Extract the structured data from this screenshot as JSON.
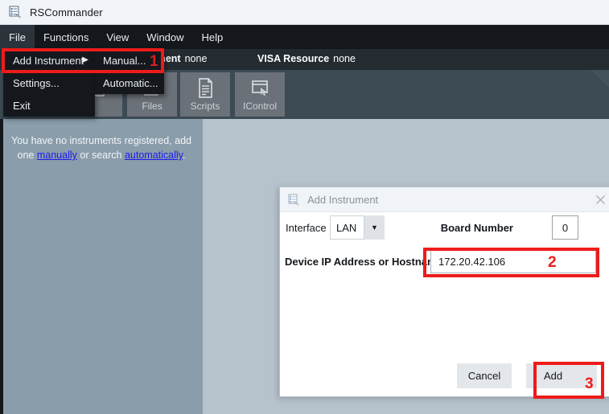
{
  "window": {
    "title": "RSCommander",
    "icon": "instrument-list-icon"
  },
  "menubar": {
    "items": [
      {
        "label": "File",
        "state": "open"
      },
      {
        "label": "Functions",
        "state": "closed"
      },
      {
        "label": "View",
        "state": "closed"
      },
      {
        "label": "Window",
        "state": "closed"
      },
      {
        "label": "Help",
        "state": "closed"
      }
    ]
  },
  "file_menu": {
    "items": [
      {
        "label": "Add Instrument",
        "has_submenu": true,
        "submenu_arrow": "▶"
      },
      {
        "label": "Settings...",
        "has_submenu": false
      },
      {
        "label": "Exit",
        "has_submenu": false
      }
    ]
  },
  "add_instrument_submenu": {
    "items": [
      {
        "label": "Manual..."
      },
      {
        "label": "Automatic..."
      }
    ]
  },
  "status_bar": {
    "instrument": {
      "label": "Instrument",
      "value": "none"
    },
    "visa_resource": {
      "label": "VISA Resource",
      "value": "none"
    }
  },
  "toolbar": {
    "buttons": [
      {
        "label": "",
        "icon": "toolbar-icon-1"
      },
      {
        "label": "",
        "icon": "toolbar-icon-2"
      },
      {
        "label": "Files",
        "icon": "files-icon"
      },
      {
        "label": "Scripts",
        "icon": "document-icon"
      },
      {
        "label": "IControl",
        "icon": "window-cursor-icon"
      }
    ]
  },
  "left_panel": {
    "empty_message_prefix": "You have no instruments registered, add one ",
    "link_manually": "manually",
    "empty_message_middle": " or search ",
    "link_automatically": "automatically",
    "empty_message_suffix": "."
  },
  "dialog": {
    "title": "Add Instrument",
    "icon": "instrument-list-icon",
    "close_glyph": "✕",
    "interface": {
      "label": "Interface",
      "value": "LAN",
      "arrow": "▼",
      "options": [
        "LAN"
      ]
    },
    "board_number": {
      "label": "Board Number",
      "value": "0"
    },
    "device_address": {
      "label": "Device IP Address or Hostname",
      "value": "172.20.42.106",
      "placeholder": ""
    },
    "buttons": {
      "cancel": "Cancel",
      "add": "Add"
    }
  },
  "annotations": {
    "steps": [
      {
        "number": "1",
        "target": "manual-menu-item"
      },
      {
        "number": "2",
        "target": "device-address-field"
      },
      {
        "number": "3",
        "target": "add-button"
      }
    ],
    "highlight_color": "#ee1b1b"
  }
}
